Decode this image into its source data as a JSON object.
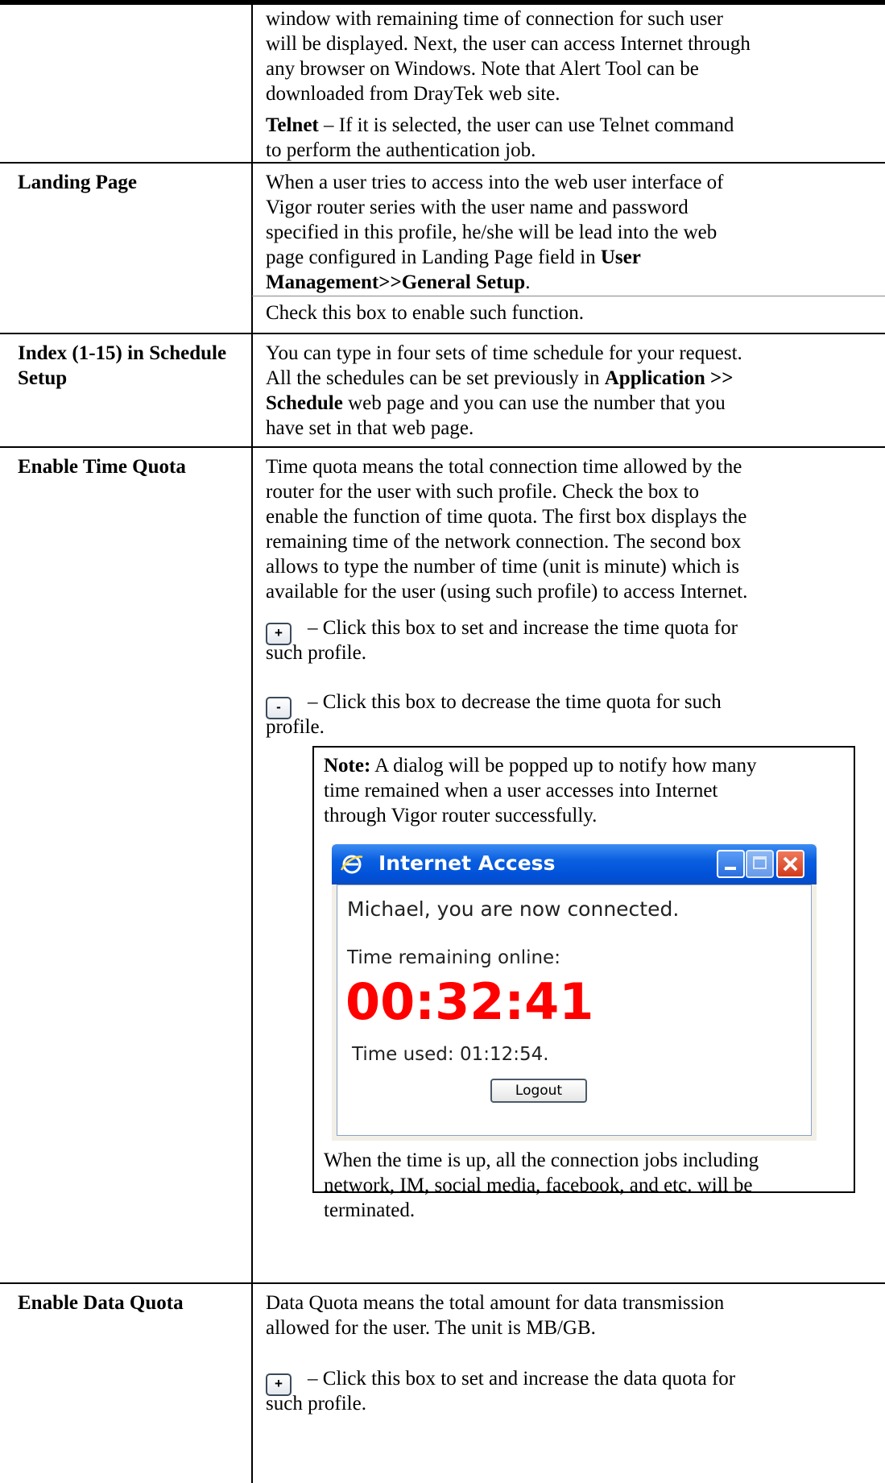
{
  "rows": [
    {
      "label": "",
      "paragraphs": [
        "window with remaining time of connection for such user",
        "will be displayed. Next, the user can access Internet through",
        "any browser on Windows. Note that Alert Tool can be",
        "downloaded from DrayTek web site."
      ],
      "telnet_bold": "Telnet",
      "telnet_rest": " – If it is selected, the user can use Telnet command",
      "telnet_line2": "to perform the authentication job."
    },
    {
      "label": "Landing Page",
      "lines": [
        "When a user tries to access into the web user interface of",
        "Vigor router series with the user name and password",
        "specified in this profile, he/she will be lead into the web"
      ],
      "line4_start": "page configured in Landing Page field in ",
      "line4_bold": "User",
      "line5_bold": "Management>>General Setup",
      "line5_end": ".",
      "check": "Check this box to enable such function."
    },
    {
      "label_line1": "Index (1-15) in Schedule",
      "label_line2": "Setup",
      "line1": "You can type in four sets of time schedule for your request.",
      "line2_start": "All the schedules can be set previously in ",
      "line2_bold": "Application >>",
      "line3_bold": "Schedule",
      "line3_end": " web page and you can use the number that you",
      "line4": "have set in that web page."
    },
    {
      "label": "Enable Time Quota",
      "lines": [
        "Time quota means the total connection time allowed by the",
        "router for the user with such profile. Check the box to",
        "enable the function of time quota. The first box displays the",
        "remaining time of the network connection. The second box",
        "allows to type the number of time (unit is minute) which is",
        "available for the user (using such profile) to access Internet."
      ],
      "plus_symbol": "+",
      "plus_line1": "– Click this box to set and increase the time quota for",
      "plus_line2": "such profile.",
      "minus_symbol": "-",
      "minus_line1": "– Click this box to decrease the time quota for such",
      "minus_line2": "profile.",
      "note_bold": "Note:",
      "note_line1": " A dialog will be popped up to notify how many",
      "note_line2": "time remained when a user accesses into Internet",
      "note_line3": "through Vigor router successfully.",
      "after_lines": [
        "When the time is up, all the connection jobs including",
        "network, IM, social media, facebook, and etc. will be",
        "terminated."
      ]
    },
    {
      "label": "Enable Data Quota",
      "lines": [
        "Data Quota means the total amount for data transmission",
        "allowed for the user. The unit is MB/GB."
      ],
      "plus_symbol": "+",
      "plus_line1": "– Click this box to set and increase the data quota for",
      "plus_line2": "such profile."
    }
  ],
  "dialog": {
    "title": "Internet Access",
    "connected": "Michael, you are now connected.",
    "remaining_label": "Time remaining online:",
    "remaining_value": "00:32:41",
    "used_label": "Time used: 01:12:54.",
    "logout": "Logout",
    "colors": {
      "title_bar": "#0a5fe0",
      "time_value": "#ff0000",
      "close_button": "#e0452a"
    }
  }
}
